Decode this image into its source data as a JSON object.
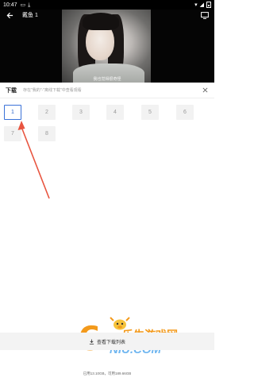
{
  "status_bar": {
    "time": "10:47"
  },
  "video": {
    "title": "戴鱼 1",
    "subtitle": "我也觉得很奇怪"
  },
  "download_panel": {
    "title": "下载",
    "hint": "存在\"我的\"-\"离线下载\"中查看观看",
    "episodes": [
      "1",
      "2",
      "3",
      "4",
      "5",
      "6",
      "7",
      "8"
    ],
    "selected_episode": "1"
  },
  "bottom": {
    "view_downloads_label": "查看下载列表",
    "storage_text": "已用13.10GB，可用189.66GB"
  },
  "watermark": {
    "cn_text": "乐牛游戏网",
    "domain_text": "NIU.COM"
  },
  "colors": {
    "accent": "#3a72d8",
    "annotation": "#e8543f",
    "watermark_orange": "#f39a1c",
    "watermark_blue": "#6fb6f0"
  }
}
